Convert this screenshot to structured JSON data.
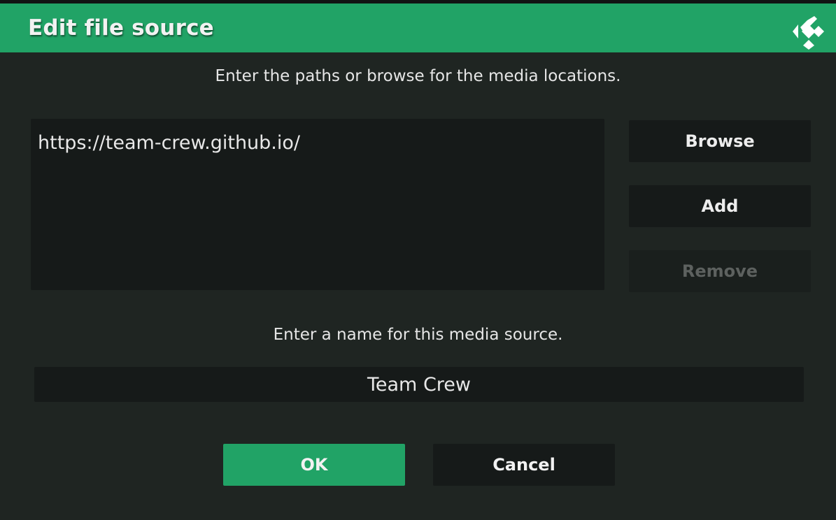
{
  "dialog": {
    "title": "Edit file source",
    "logo_icon": "kodi-logo-icon"
  },
  "paths_section": {
    "instruction": "Enter the paths or browse for the media locations.",
    "paths": [
      "https://team-crew.github.io/"
    ]
  },
  "side_buttons": {
    "browse_label": "Browse",
    "add_label": "Add",
    "remove_label": "Remove",
    "remove_disabled": true
  },
  "name_section": {
    "instruction": "Enter a name for this media source.",
    "value": "Team Crew"
  },
  "footer": {
    "ok_label": "OK",
    "cancel_label": "Cancel"
  },
  "colors": {
    "accent": "#21a366",
    "background": "#1f2522",
    "field": "#161a19"
  }
}
